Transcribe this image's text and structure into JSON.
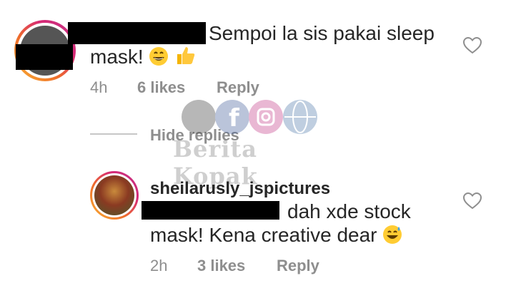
{
  "comments": [
    {
      "text": "Sempoi la sis pakai sleep",
      "text2": "mask!",
      "emojis": [
        "grinning-face-emoji",
        "thumbs-up-emoji"
      ],
      "time": "4h",
      "likes": "6 likes",
      "reply": "Reply"
    }
  ],
  "hide_replies": "Hide replies",
  "reply": {
    "username": "sheilarusly_jspictures",
    "text": "dah xde stock",
    "text2": "mask! Kena creative dear",
    "emoji": "sweat-smile-emoji",
    "time": "2h",
    "likes": "3 likes",
    "reply": "Reply"
  },
  "watermark": {
    "text": "Berita Kopak",
    "icons": [
      "video-icon",
      "facebook-icon",
      "instagram-icon",
      "globe-icon"
    ]
  },
  "colors": {
    "text": "#262626",
    "muted": "#8e8e8e",
    "ring_start": "#f9b233",
    "ring_end": "#c13584"
  }
}
